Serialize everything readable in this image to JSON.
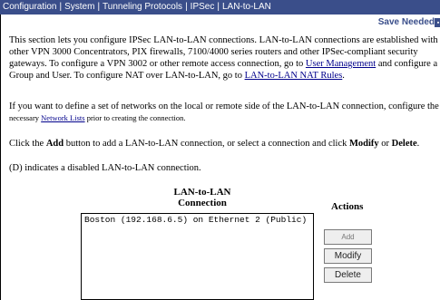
{
  "breadcrumb": {
    "items": [
      "Configuration",
      "System",
      "Tunneling Protocols",
      "IPSec",
      "LAN-to-LAN"
    ],
    "separator": "|"
  },
  "header": {
    "save_needed_label": "Save Needed"
  },
  "intro": {
    "line1": "This section lets you configure IPSec LAN-to-LAN connections. LAN-to-LAN connections are established with",
    "line2": "other VPN 3000 Concentrators, PIX firewalls, 7100/4000 series routers and other IPSec-compliant security",
    "line3_pre": "gateways. To configure a VPN 3002 or other remote access connection, go to ",
    "user_mgmt_link": "User Management",
    "line3_post": " and configure a",
    "line4_pre": "Group and User. To configure NAT over LAN-to-LAN, go to ",
    "nat_rules_link": "LAN-to-LAN NAT Rules",
    "line4_post": "."
  },
  "networks": {
    "line1": "If you want to define a set of networks on the local or remote side of the LAN-to-LAN connection, configure the",
    "small_pre": "necessary ",
    "network_lists_link": "Network Lists",
    "small_post": " prior to creating the connection."
  },
  "instructions": {
    "pre": "Click the ",
    "add_word": "Add",
    "mid1": " button to add a LAN-to-LAN connection, or select a connection and click ",
    "modify_word": "Modify",
    "mid2": " or ",
    "delete_word": "Delete",
    "post": "."
  },
  "disabled_note": "(D) indicates a disabled LAN-to-LAN connection.",
  "table": {
    "heading_line1": "LAN-to-LAN",
    "heading_line2": "Connection",
    "actions_heading": "Actions",
    "connections": [
      "Boston (192.168.6.5) on Ethernet 2 (Public)"
    ]
  },
  "buttons": {
    "add": "Add",
    "modify": "Modify",
    "delete": "Delete"
  },
  "colors": {
    "titlebar_bg": "#3a4e8a",
    "link": "#00008b"
  }
}
